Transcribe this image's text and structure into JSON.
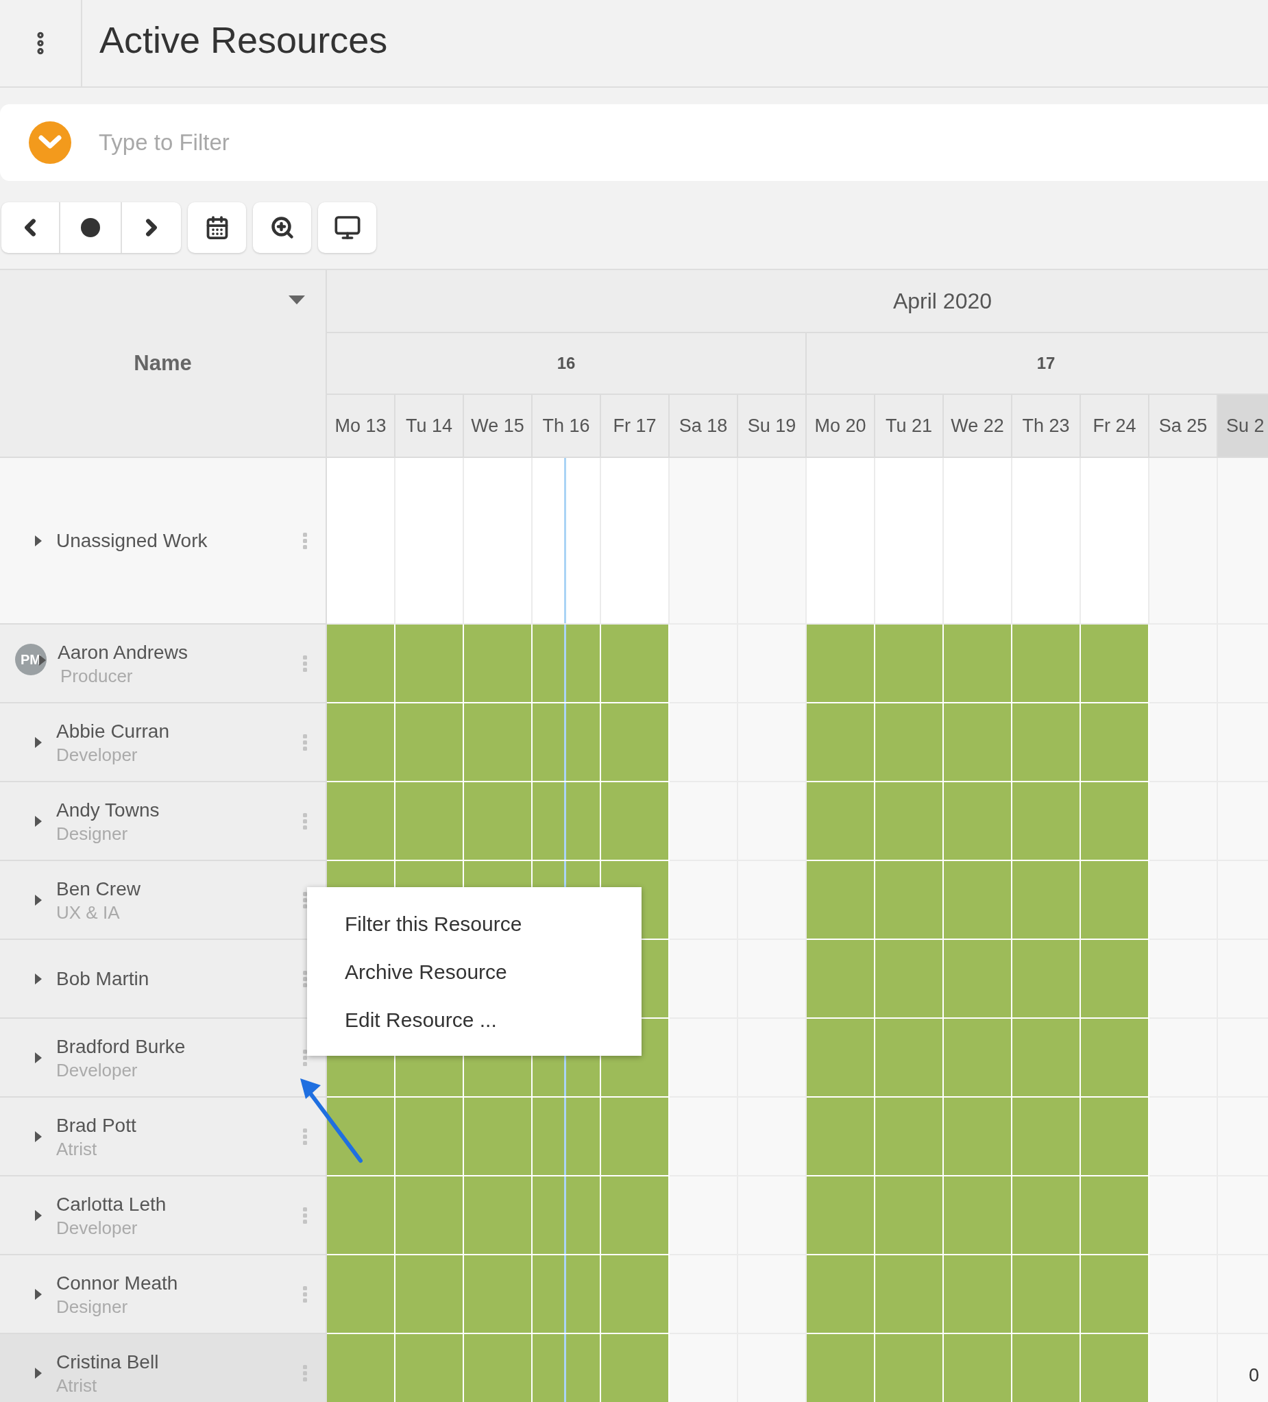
{
  "header": {
    "title": "Active Resources"
  },
  "filter": {
    "placeholder": "Type to Filter"
  },
  "grid": {
    "name_column": "Name",
    "month": "April 2020",
    "weeks": [
      {
        "label": "16",
        "days": [
          {
            "label": "Mo 13",
            "kind": "weekday",
            "highlighted": false
          },
          {
            "label": "Tu 14",
            "kind": "weekday",
            "highlighted": false
          },
          {
            "label": "We 15",
            "kind": "weekday",
            "highlighted": false
          },
          {
            "label": "Th 16",
            "kind": "weekday",
            "highlighted": false,
            "today": true
          },
          {
            "label": "Fr 17",
            "kind": "weekday",
            "highlighted": false
          },
          {
            "label": "Sa 18",
            "kind": "weekend",
            "highlighted": false
          },
          {
            "label": "Su 19",
            "kind": "weekend",
            "highlighted": false
          }
        ]
      },
      {
        "label": "17",
        "days": [
          {
            "label": "Mo 20",
            "kind": "weekday",
            "highlighted": false
          },
          {
            "label": "Tu 21",
            "kind": "weekday",
            "highlighted": false
          },
          {
            "label": "We 22",
            "kind": "weekday",
            "highlighted": false
          },
          {
            "label": "Th 23",
            "kind": "weekday",
            "highlighted": false
          },
          {
            "label": "Fr 24",
            "kind": "weekday",
            "highlighted": false
          },
          {
            "label": "Sa 25",
            "kind": "weekend",
            "highlighted": false
          },
          {
            "label": "Su 2",
            "kind": "weekend",
            "highlighted": true
          }
        ]
      }
    ],
    "rows": [
      {
        "name": "Unassigned Work",
        "kind": "unassigned",
        "highlighted": false
      },
      {
        "name": "Aaron Andrews",
        "role": "Producer",
        "avatar": "PM",
        "kind": "resource",
        "highlighted": false
      },
      {
        "name": "Abbie Curran",
        "role": "Developer",
        "kind": "resource",
        "highlighted": false
      },
      {
        "name": "Andy Towns",
        "role": "Designer",
        "kind": "resource",
        "highlighted": false
      },
      {
        "name": "Ben Crew",
        "role": "UX & IA",
        "kind": "resource",
        "highlighted": false
      },
      {
        "name": "Bob Martin",
        "kind": "resource",
        "highlighted": false
      },
      {
        "name": "Bradford Burke",
        "role": "Developer",
        "kind": "resource",
        "highlighted": false
      },
      {
        "name": "Brad Pott",
        "role": "Atrist",
        "kind": "resource",
        "highlighted": false
      },
      {
        "name": "Carlotta Leth",
        "role": "Developer",
        "kind": "resource",
        "highlighted": false
      },
      {
        "name": "Connor Meath",
        "role": "Designer",
        "kind": "resource",
        "highlighted": false
      },
      {
        "name": "Cristina Bell",
        "role": "Atrist",
        "kind": "resource",
        "highlighted": true,
        "count": "0"
      }
    ]
  },
  "context_menu": {
    "items": [
      "Filter this Resource",
      "Archive Resource",
      "Edit Resource ..."
    ]
  }
}
